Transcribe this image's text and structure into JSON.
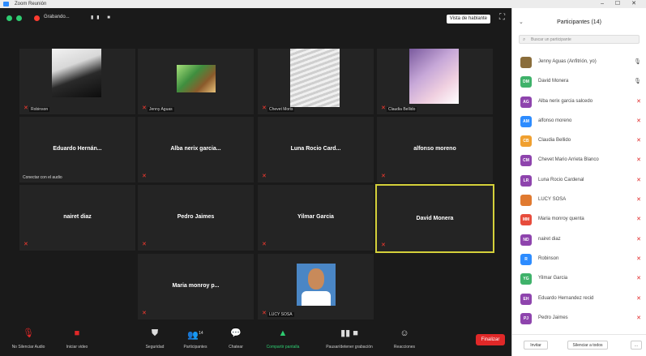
{
  "window": {
    "title": "Zoom Reunión",
    "controls": "– ☐ ✕"
  },
  "topbar": {
    "meeting_info": "Grabando...",
    "view_label": "Vista de hablante"
  },
  "tiles": [
    {
      "name": "",
      "tag": "Robinson",
      "muted": true
    },
    {
      "name": "",
      "tag": "Jenny Aguas",
      "muted": true
    },
    {
      "name": "",
      "tag": "Chevet Moris",
      "muted": true
    },
    {
      "name": "",
      "tag": "Claudia Bellido",
      "muted": true
    },
    {
      "name": "Eduardo Hernán...",
      "conn": "Conectar con el audio",
      "muted": false
    },
    {
      "name": "Alba nerix garcia...",
      "muted": true
    },
    {
      "name": "Luna Rocio Card...",
      "muted": true
    },
    {
      "name": "alfonso moreno",
      "muted": true
    },
    {
      "name": "nairet diaz",
      "muted": true
    },
    {
      "name": "Pedro Jaimes",
      "muted": true
    },
    {
      "name": "Yilmar Garcia",
      "muted": true
    },
    {
      "name": "David Monera",
      "muted": true
    },
    {
      "name": "Maria monroy p...",
      "muted": true
    },
    {
      "name": "",
      "tag": "LUCY SOSA",
      "muted": true
    }
  ],
  "toolbar": {
    "audio": "No Silenciar Audio",
    "video": "Iniciar video",
    "security": "Seguridad",
    "participants": "Participantes",
    "participants_count": "14",
    "chat": "Chatear",
    "share": "Compartir pantalla",
    "record": "Pausar/detener grabación",
    "reactions": "Reacciones",
    "end": "Finalizar"
  },
  "panel": {
    "title": "Participantes (14)",
    "search_placeholder": "Buscar un participante",
    "participants": [
      {
        "initials": "",
        "name": "Jenny Aguas (Anfitrión, yo)",
        "color": "#8a6d3b",
        "mic_on": true
      },
      {
        "initials": "DM",
        "name": "David Monera",
        "color": "#3fb26a",
        "mic_on": true
      },
      {
        "initials": "AG",
        "name": "Alba nerix garcia salcedo",
        "color": "#8e44ad",
        "mic_on": false
      },
      {
        "initials": "AM",
        "name": "alfonso moreno",
        "color": "#2d8cff",
        "mic_on": false
      },
      {
        "initials": "CB",
        "name": "Claudia Bellido",
        "color": "#f0a030",
        "mic_on": false
      },
      {
        "initials": "CM",
        "name": "Chevet Mario Arrieta Blanco",
        "color": "#8e44ad",
        "mic_on": false
      },
      {
        "initials": "LR",
        "name": "Luna Rocio Cardenal",
        "color": "#8e44ad",
        "mic_on": false
      },
      {
        "initials": "",
        "name": "LUCY SOSA",
        "color": "#e07a30",
        "mic_on": false
      },
      {
        "initials": "MM",
        "name": "Maria monroy quenta",
        "color": "#e74c3c",
        "mic_on": false
      },
      {
        "initials": "ND",
        "name": "nairet diaz",
        "color": "#8e44ad",
        "mic_on": false
      },
      {
        "initials": "R",
        "name": "Robinson",
        "color": "#2d8cff",
        "mic_on": false
      },
      {
        "initials": "YG",
        "name": "Yilmar Garcia",
        "color": "#3fb26a",
        "mic_on": false
      },
      {
        "initials": "EH",
        "name": "Eduardo Hernandez recid",
        "color": "#8e44ad",
        "mic_on": false
      },
      {
        "initials": "PJ",
        "name": "Pedro Jaimes",
        "color": "#8e44ad",
        "mic_on": false
      }
    ],
    "invite": "Invitar",
    "mute_all": "Silenciar a todos",
    "more": "..."
  }
}
